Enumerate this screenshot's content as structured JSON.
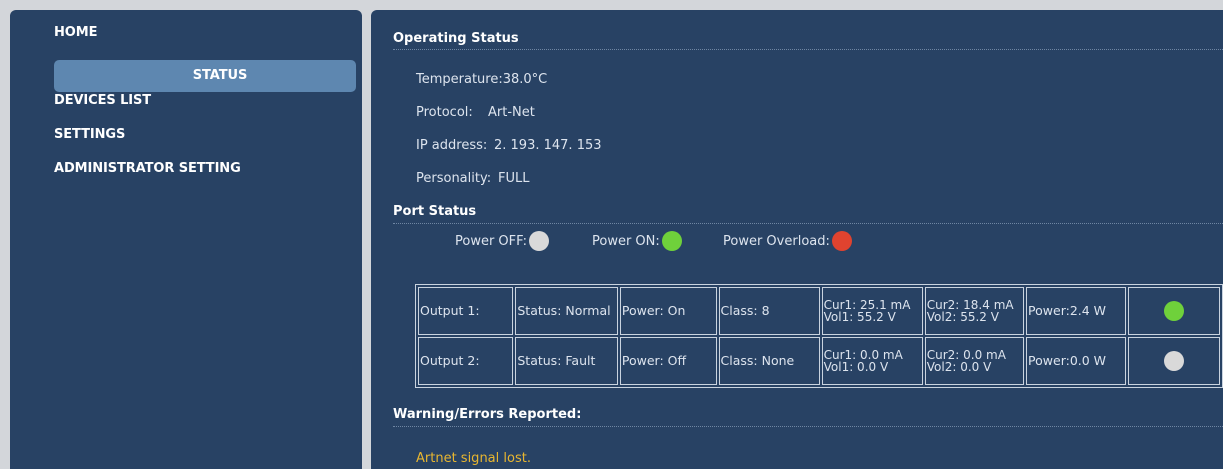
{
  "nav": {
    "home": "HOME",
    "status": "STATUS",
    "devices": "DEVICES LIST",
    "settings": "SETTINGS",
    "admin": "ADMINISTRATOR SETTING"
  },
  "operating": {
    "title": "Operating Status",
    "temperature_label": "Temperature:",
    "temperature_value": "38.0°C",
    "protocol_label": "Protocol:",
    "protocol_value": "Art-Net",
    "ip_label": "IP address:",
    "ip_value": "2. 193. 147. 153",
    "personality_label": "Personality:",
    "personality_value": "FULL"
  },
  "port_status": {
    "title": "Port Status",
    "legend": {
      "off_label": "Power OFF:",
      "on_label": "Power ON:",
      "overload_label": "Power Overload:",
      "off_color": "#d9d9d9",
      "on_color": "#6fd13b",
      "overload_color": "#e0432f"
    },
    "outputs": [
      {
        "name": "Output 1:",
        "status": "Status: Normal",
        "power": "Power: On",
        "class": "Class: 8",
        "cur1": "Cur1: 25.1 mA",
        "vol1": "Vol1: 55.2 V",
        "cur2": "Cur2: 18.4 mA",
        "vol2": "Vol2: 55.2 V",
        "watts": "Power:2.4 W",
        "indicator_color": "#6fd13b"
      },
      {
        "name": "Output 2:",
        "status": "Status: Fault",
        "power": "Power: Off",
        "class": "Class: None",
        "cur1": "Cur1: 0.0 mA",
        "vol1": "Vol1: 0.0 V",
        "cur2": "Cur2: 0.0 mA",
        "vol2": "Vol2: 0.0 V",
        "watts": "Power:0.0 W",
        "indicator_color": "#d9d9d9"
      }
    ]
  },
  "warnings": {
    "title": "Warning/Errors Reported:",
    "messages": [
      "Artnet signal lost."
    ],
    "message_color": "#e8b630"
  }
}
